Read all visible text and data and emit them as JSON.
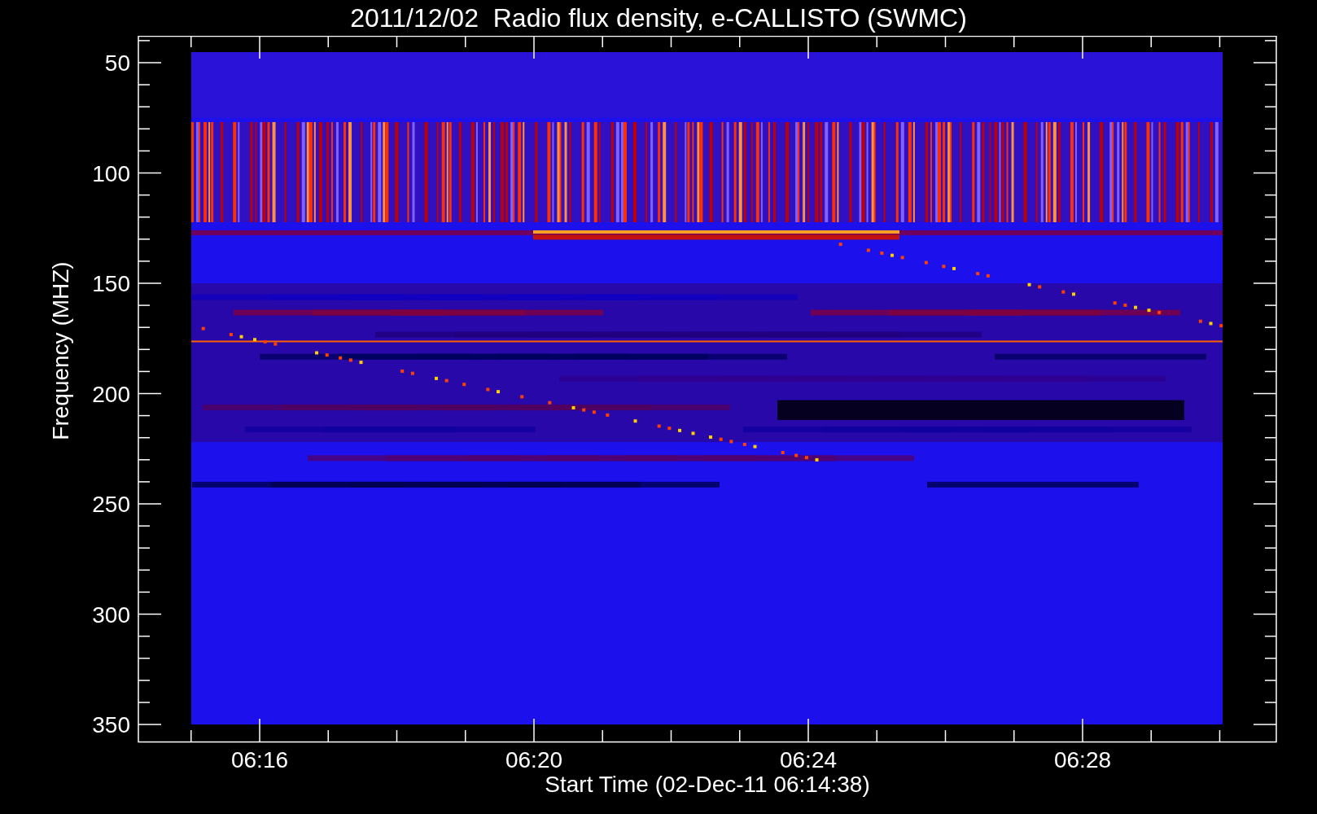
{
  "title": "2011/12/02  Radio flux density, e-CALLISTO (SWMC)",
  "y_axis": {
    "label": "Frequency (MHZ)",
    "ticks": [
      "50",
      "100",
      "150",
      "200",
      "250",
      "300",
      "350"
    ]
  },
  "x_axis": {
    "label": "Start Time (02-Dec-11 06:14:38)",
    "ticks": [
      "06:16",
      "06:20",
      "06:24",
      "06:28"
    ]
  }
}
